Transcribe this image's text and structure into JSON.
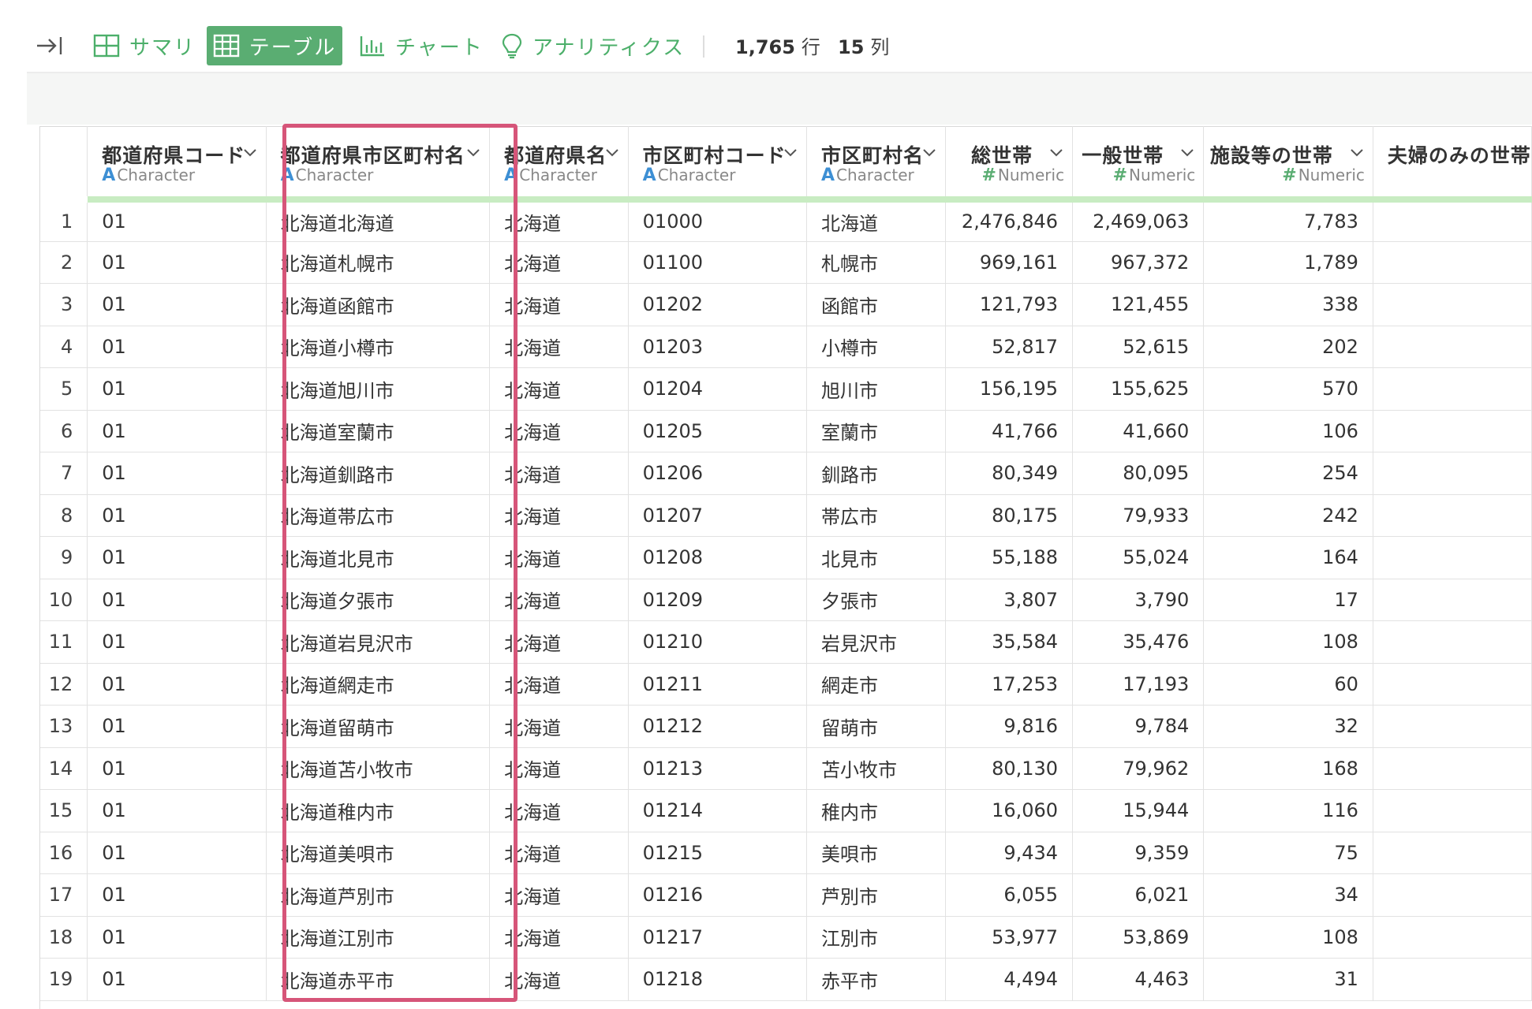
{
  "toolbar": {
    "summary_label": "サマリ",
    "table_label": "テーブル",
    "chart_label": "チャート",
    "analytics_label": "アナリティクス",
    "rows_count": "1,765",
    "rows_unit": "行",
    "cols_count": "15",
    "cols_unit": "列",
    "accent_color": "#5aad72"
  },
  "columns": [
    {
      "name": "都道府県コード",
      "type": "Character"
    },
    {
      "name": "都道府県市区町村名",
      "type": "Character"
    },
    {
      "name": "都道府県名",
      "type": "Character"
    },
    {
      "name": "市区町村コード",
      "type": "Character"
    },
    {
      "name": "市区町村名",
      "type": "Character"
    },
    {
      "name": "総世帯",
      "type": "Numeric"
    },
    {
      "name": "一般世帯",
      "type": "Numeric"
    },
    {
      "name": "施設等の世帯",
      "type": "Numeric"
    },
    {
      "name": "夫婦のみの世帯",
      "type": ""
    }
  ],
  "type_icons": {
    "Character": "A",
    "Numeric": "#"
  },
  "selected_column_color": "#d65579",
  "rows": [
    [
      "1",
      "01",
      "北海道北海道",
      "北海道",
      "01000",
      "北海道",
      "2,476,846",
      "2,469,063",
      "7,783"
    ],
    [
      "2",
      "01",
      "北海道札幌市",
      "北海道",
      "01100",
      "札幌市",
      "969,161",
      "967,372",
      "1,789"
    ],
    [
      "3",
      "01",
      "北海道函館市",
      "北海道",
      "01202",
      "函館市",
      "121,793",
      "121,455",
      "338"
    ],
    [
      "4",
      "01",
      "北海道小樽市",
      "北海道",
      "01203",
      "小樽市",
      "52,817",
      "52,615",
      "202"
    ],
    [
      "5",
      "01",
      "北海道旭川市",
      "北海道",
      "01204",
      "旭川市",
      "156,195",
      "155,625",
      "570"
    ],
    [
      "6",
      "01",
      "北海道室蘭市",
      "北海道",
      "01205",
      "室蘭市",
      "41,766",
      "41,660",
      "106"
    ],
    [
      "7",
      "01",
      "北海道釧路市",
      "北海道",
      "01206",
      "釧路市",
      "80,349",
      "80,095",
      "254"
    ],
    [
      "8",
      "01",
      "北海道帯広市",
      "北海道",
      "01207",
      "帯広市",
      "80,175",
      "79,933",
      "242"
    ],
    [
      "9",
      "01",
      "北海道北見市",
      "北海道",
      "01208",
      "北見市",
      "55,188",
      "55,024",
      "164"
    ],
    [
      "10",
      "01",
      "北海道夕張市",
      "北海道",
      "01209",
      "夕張市",
      "3,807",
      "3,790",
      "17"
    ],
    [
      "11",
      "01",
      "北海道岩見沢市",
      "北海道",
      "01210",
      "岩見沢市",
      "35,584",
      "35,476",
      "108"
    ],
    [
      "12",
      "01",
      "北海道網走市",
      "北海道",
      "01211",
      "網走市",
      "17,253",
      "17,193",
      "60"
    ],
    [
      "13",
      "01",
      "北海道留萌市",
      "北海道",
      "01212",
      "留萌市",
      "9,816",
      "9,784",
      "32"
    ],
    [
      "14",
      "01",
      "北海道苫小牧市",
      "北海道",
      "01213",
      "苫小牧市",
      "80,130",
      "79,962",
      "168"
    ],
    [
      "15",
      "01",
      "北海道稚内市",
      "北海道",
      "01214",
      "稚内市",
      "16,060",
      "15,944",
      "116"
    ],
    [
      "16",
      "01",
      "北海道美唄市",
      "北海道",
      "01215",
      "美唄市",
      "9,434",
      "9,359",
      "75"
    ],
    [
      "17",
      "01",
      "北海道芦別市",
      "北海道",
      "01216",
      "芦別市",
      "6,055",
      "6,021",
      "34"
    ],
    [
      "18",
      "01",
      "北海道江別市",
      "北海道",
      "01217",
      "江別市",
      "53,977",
      "53,869",
      "108"
    ],
    [
      "19",
      "01",
      "北海道赤平市",
      "北海道",
      "01218",
      "赤平市",
      "4,494",
      "4,463",
      "31"
    ]
  ]
}
